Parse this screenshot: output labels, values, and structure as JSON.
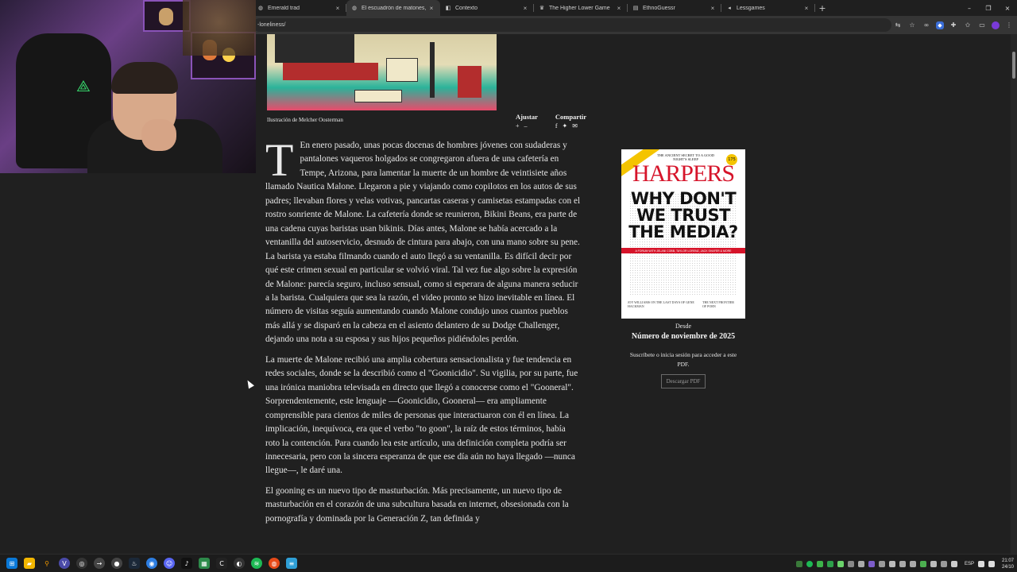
{
  "browser": {
    "tabs": [
      {
        "label": "Emerald trad",
        "icon": "globe-icon",
        "active": false
      },
      {
        "label": "El escuadrón de matones, de D",
        "icon": "globe-icon",
        "active": true
      },
      {
        "label": "Contexto",
        "icon": "context-icon",
        "active": false
      },
      {
        "label": "The Higher Lower Game",
        "icon": "game-icon",
        "active": false
      },
      {
        "label": "EthnoGuessr",
        "icon": "map-icon",
        "active": false
      },
      {
        "label": "Lessgames",
        "icon": "lessgames-icon",
        "active": false
      }
    ],
    "tab_close": "×",
    "new_tab": "+",
    "url": "-loneliness/",
    "window_controls": {
      "minimize": "–",
      "restore": "❐",
      "close": "×"
    }
  },
  "article": {
    "image_caption": "Ilustración de Melcher Oosterman",
    "tools": [
      {
        "label": "Ajustar",
        "icons": "+ –"
      },
      {
        "label": "Compartir",
        "icons": "f ✦ ✉"
      }
    ],
    "dropcap": "T",
    "paragraphs": [
      "En enero pasado, unas pocas docenas de hombres jóvenes con sudaderas y pantalones vaqueros holgados se congregaron afuera de una cafetería en Tempe, Arizona, para lamentar la muerte de un hombre de veintisiete años llamado Nautica Malone. Llegaron a pie y viajando como copilotos en los autos de sus padres; llevaban flores y velas votivas, pancartas caseras y camisetas estampadas con el rostro sonriente de Malone. La cafetería donde se reunieron, Bikini Beans, era parte de una cadena cuyas baristas usan bikinis. Días antes, Malone se había acercado a la ventanilla del autoservicio, desnudo de cintura para abajo, con una mano sobre su pene. La barista ya estaba filmando cuando el auto llegó a su ventanilla. Es difícil decir por qué este crimen sexual en particular se volvió viral. Tal vez fue algo sobre la expresión de Malone: parecía seguro, incluso sensual, como si esperara de alguna manera seducir a la barista. Cualquiera que sea la razón, el video pronto se hizo inevitable en línea. El número de visitas seguía aumentando cuando Malone condujo unos cuantos pueblos más allá y se disparó en la cabeza en el asiento delantero de su Dodge Challenger, dejando una nota a su esposa y sus hijos pequeños pidiéndoles perdón.",
      "La muerte de Malone recibió una amplia cobertura sensacionalista y fue tendencia en redes sociales, donde se la describió como el \"Goonicidio\". Su vigilia, por su parte, fue una irónica maniobra televisada en directo que llegó a conocerse como el \"Gooneral\". Sorprendentemente, este lenguaje —Goonicidio, Gooneral— era ampliamente comprensible para cientos de miles de personas que interactuaron con él en línea. La implicación, inequívoca, era que el verbo \"to goon\", la raíz de estos términos, había roto la contención. Para cuando lea este artículo, una definición completa podría ser innecesaria, pero con la sincera esperanza de que ese día aún no haya llegado —nunca llegue—, le daré una.",
      "El gooning es un nuevo tipo de masturbación. Más precisamente, un nuevo tipo de masturbación en el corazón de una subcultura basada en internet, obsesionada con la pornografía y dominada por la Generación Z, tan definida y"
    ]
  },
  "sidebar": {
    "cover": {
      "tagline": "THE ANCIENT SECRET TO A GOOD NIGHT'S SLEEP",
      "masthead": "HARPERS",
      "badge": "175",
      "headline": "WHY DON'T WE TRUST THE MEDIA?",
      "banner": "A FORUM WITH JELANI COBB, TAYLOR LORENZ, JACK SHAFER & MORE",
      "foot_left": "JOY WILLIAMS ON THE LAST DAYS OF GENE HACKMAN",
      "foot_right": "THE NEXT FRONTIER OF PORN"
    },
    "since_label": "Desde",
    "issue_label": "Número de noviembre de 2025",
    "subscribe_text": "Suscríbete o inicia sesión para acceder a este PDF.",
    "download_button": "Descargar PDF"
  },
  "taskbar": {
    "language": "ESP",
    "time": "21:07",
    "date": "24/10"
  },
  "colors": {
    "page_bg": "#202020",
    "harpers_red": "#d6142a",
    "accent_yellow": "#f4c400"
  }
}
